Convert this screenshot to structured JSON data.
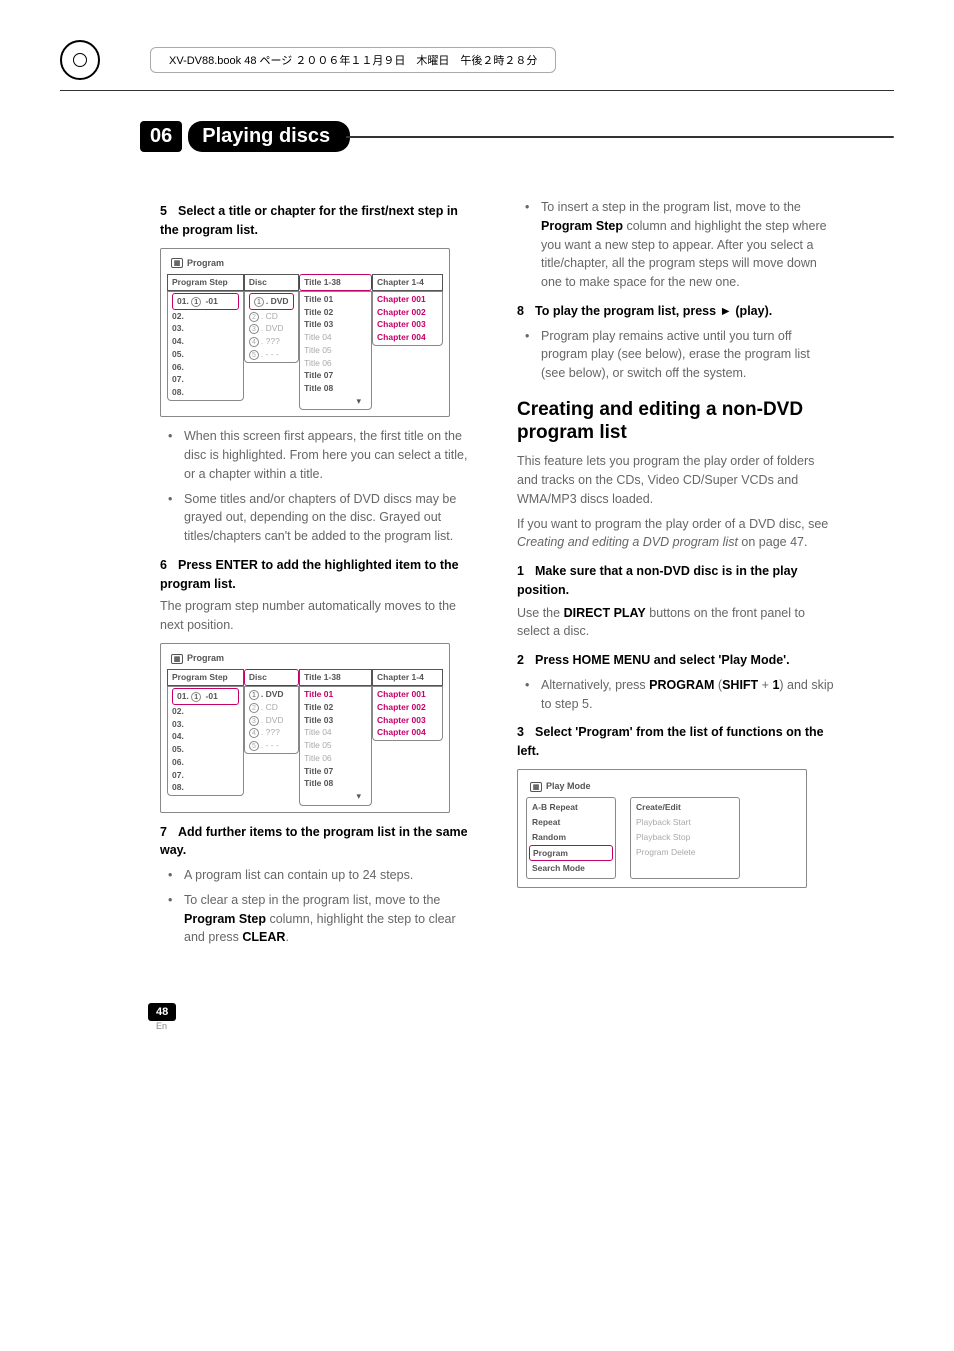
{
  "header_text": "XV-DV88.book  48 ページ  ２００６年１１月９日　木曜日　午後２時２８分",
  "chapter": {
    "num": "06",
    "title": "Playing discs"
  },
  "left": {
    "step5": {
      "num": "5",
      "text": "Select a title or chapter for the first/next step in the program list."
    },
    "table1": {
      "title": "Program",
      "headers": [
        "Program Step",
        "Disc",
        "Title 1-38",
        "Chapter 1-4"
      ],
      "steps": [
        "01.     -01",
        "02.",
        "03.",
        "04.",
        "05.",
        "06.",
        "07.",
        "08."
      ],
      "step_nums": [
        "1",
        "2",
        "3",
        "4",
        "5"
      ],
      "discs": [
        ". DVD",
        ". CD",
        ". DVD",
        ". ???",
        ". - - -"
      ],
      "titles": [
        "Title 01",
        "Title 02",
        "Title 03",
        "Title 04",
        "Title 05",
        "Title 06",
        "Title 07",
        "Title 08"
      ],
      "chapters": [
        "Chapter 001",
        "Chapter 002",
        "Chapter 003",
        "Chapter 004"
      ]
    },
    "bullets1": [
      "When this screen first appears, the first title on the disc is highlighted. From here you can select a title, or a chapter within a title.",
      "Some titles and/or chapters of DVD discs may be grayed out, depending on the disc. Grayed out titles/chapters can't be added to the program list."
    ],
    "step6": {
      "num": "6",
      "text": "Press ENTER to add the highlighted item to the program list."
    },
    "after6": "The program step number automatically moves to the next position.",
    "step7": {
      "num": "7",
      "text": "Add further items to the program list in the same way."
    },
    "bullets7": [
      {
        "pre": "A program list can contain up to 24 steps."
      },
      {
        "pre": "To clear a step in the program list, move to the ",
        "b1": "Program Step",
        "mid": " column, highlight the step to clear and press ",
        "b2": "CLEAR",
        "post": "."
      }
    ]
  },
  "right": {
    "bulletTop": {
      "pre": "To insert a step in the program list, move to the ",
      "b1": "Program Step",
      "post": " column and highlight the step where you want a new step to appear. After you select a title/chapter, all the program steps will move down one to make space for the new one."
    },
    "step8": {
      "num": "8",
      "pre": "To play the program list, press ",
      "sym": "►",
      "post": " (play)."
    },
    "bullets8": [
      "Program play remains active until you turn off program play (see below), erase the program list (see below), or switch off the system."
    ],
    "h2": "Creating and editing a non-DVD program list",
    "p1": "This feature lets you program the play order of folders and tracks on the CDs, Video CD/Super VCDs and WMA/MP3 discs loaded.",
    "p2": {
      "pre": "If you want to program the play order of a DVD disc, see ",
      "it": "Creating and editing a DVD program list",
      "post": " on page 47."
    },
    "s1": {
      "num": "1",
      "text": "Make sure that a non-DVD disc is in the play position."
    },
    "s1b": {
      "pre": "Use the ",
      "b": "DIRECT PLAY",
      "post": " buttons on the front panel to select a disc."
    },
    "s2": {
      "num": "2",
      "text": "Press HOME MENU and select 'Play Mode'."
    },
    "s2bul": {
      "pre": "Alternatively, press ",
      "b1": "PROGRAM",
      "mid": " (",
      "b2": "SHIFT",
      "plus": " + ",
      "b3": "1",
      "post": ") and skip to step 5."
    },
    "s3": {
      "num": "3",
      "text": "Select 'Program' from the list of functions on the left."
    },
    "playmode": {
      "title": "Play Mode",
      "left": [
        "A-B Repeat",
        "Repeat",
        "Random",
        "Program",
        "Search Mode"
      ],
      "right": [
        "Create/Edit",
        "Playback Start",
        "Playback Stop",
        "Program Delete"
      ]
    }
  },
  "page_num": "48",
  "page_lang": "En"
}
